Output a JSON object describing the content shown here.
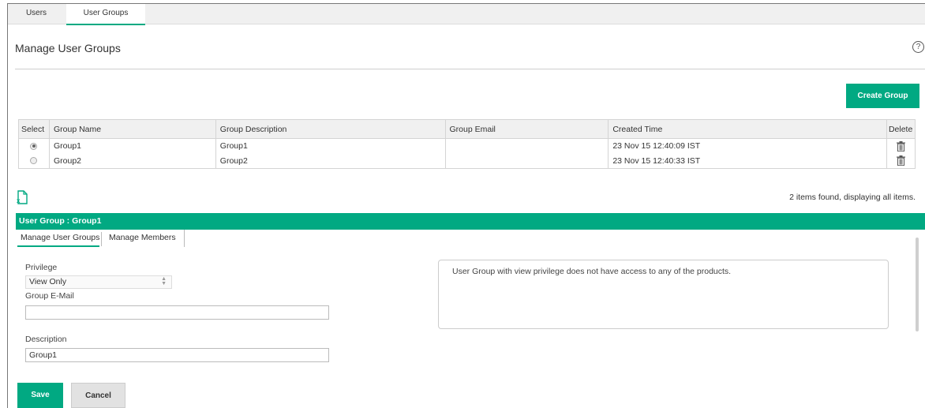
{
  "top_tabs": [
    {
      "label": "Users"
    },
    {
      "label": "User Groups"
    }
  ],
  "page": {
    "title": "Manage User Groups",
    "help_icon": "help-circle-icon",
    "accent_color": "#01a982"
  },
  "actions": {
    "create_group_label": "Create Group"
  },
  "table": {
    "headers": [
      "Select",
      "Group Name",
      "Group Description",
      "Group Email",
      "Created Time",
      "Delete"
    ],
    "rows": [
      {
        "selected": true,
        "name": "Group1",
        "description": "Group1",
        "email": "",
        "created": "23 Nov 15 12:40:09 IST",
        "delete_icon": "trash-icon"
      },
      {
        "selected": false,
        "name": "Group2",
        "description": "Group2",
        "email": "",
        "created": "23 Nov 15 12:40:33 IST",
        "delete_icon": "trash-icon"
      }
    ],
    "export_icon": "excel-export-icon",
    "items_found": "2 items found, displaying all items."
  },
  "detail": {
    "header": "User Group : Group1",
    "tabs": [
      {
        "label": "Manage User Groups"
      },
      {
        "label": "Manage Members"
      }
    ],
    "privilege_label": "Privilege",
    "privilege_value": "View Only",
    "email_label": "Group E-Mail",
    "email_value": "",
    "description_label": "Description",
    "description_value": "Group1",
    "info_text": "User Group with view privilege does not have access to any of the products."
  },
  "footer": {
    "save_label": "Save",
    "cancel_label": "Cancel"
  }
}
